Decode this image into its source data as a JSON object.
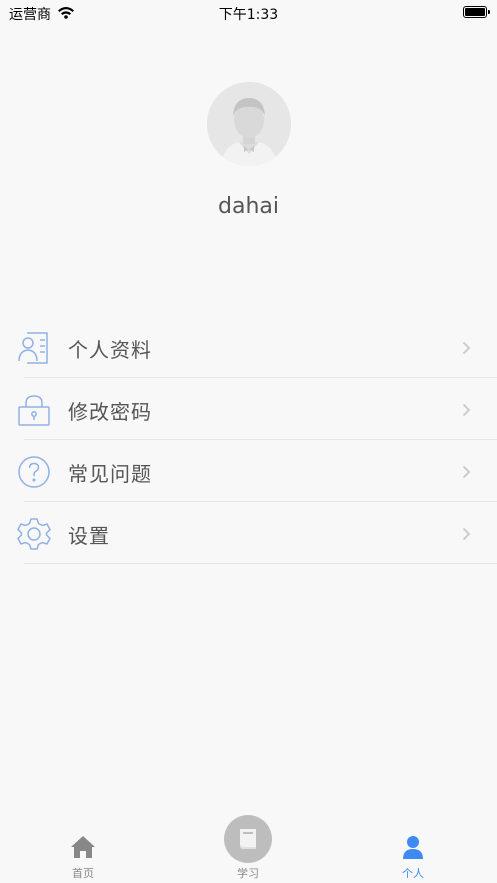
{
  "status_bar": {
    "carrier": "运营商",
    "time": "下午1:33"
  },
  "profile": {
    "username": "dahai"
  },
  "menu": {
    "items": [
      {
        "label": "个人资料",
        "icon": "contact-card-icon"
      },
      {
        "label": "修改密码",
        "icon": "lock-icon"
      },
      {
        "label": "常见问题",
        "icon": "question-circle-icon"
      },
      {
        "label": "设置",
        "icon": "gear-icon"
      }
    ]
  },
  "tab_bar": {
    "tabs": [
      {
        "label": "首页",
        "icon": "home-icon",
        "active": false
      },
      {
        "label": "学习",
        "icon": "book-icon",
        "active": false
      },
      {
        "label": "个人",
        "icon": "person-icon",
        "active": true
      }
    ]
  },
  "colors": {
    "accent": "#3d8bf2",
    "icon_blue": "#8fb1e6",
    "background": "#f8f8f8",
    "inactive_tab": "#888888"
  }
}
